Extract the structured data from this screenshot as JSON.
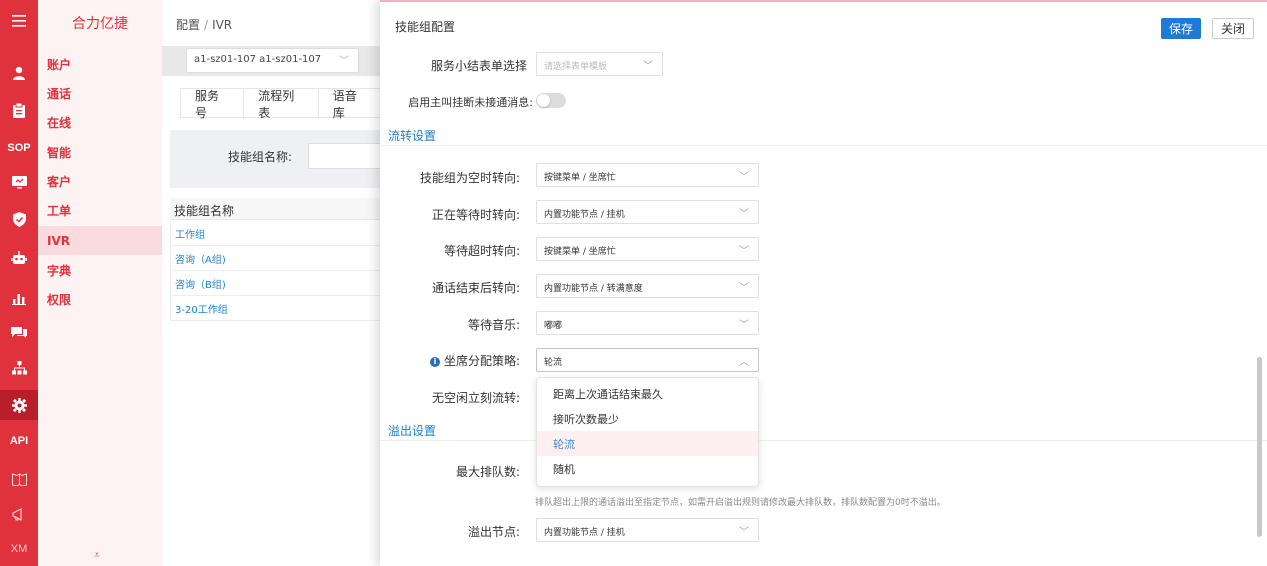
{
  "rail": {
    "items": [
      {
        "icon": "menu-icon",
        "glyph": "≡"
      },
      {
        "icon": "user-icon",
        "glyph": "♟"
      },
      {
        "icon": "clipboard-icon",
        "glyph": "▤"
      },
      {
        "icon": "sop-icon",
        "text": "SOP"
      },
      {
        "icon": "monitor-icon",
        "glyph": "▣"
      },
      {
        "icon": "shield-icon",
        "glyph": "⛉"
      },
      {
        "icon": "robot-icon",
        "glyph": "⚇"
      },
      {
        "icon": "bar-chart-icon",
        "glyph": "▁▃▆"
      },
      {
        "icon": "chat-icon",
        "glyph": "✉"
      },
      {
        "icon": "org-chart-icon",
        "glyph": "⚲"
      },
      {
        "icon": "gear-icon",
        "glyph": "✹"
      },
      {
        "icon": "api-icon",
        "text": "API"
      },
      {
        "icon": "book-icon",
        "glyph": "⊞"
      },
      {
        "icon": "megaphone-icon",
        "glyph": "◁"
      },
      {
        "icon": "xm-icon",
        "text": "XM"
      }
    ]
  },
  "menu": {
    "brand": "合力亿捷",
    "items": [
      "账户",
      "通话",
      "在线",
      "智能",
      "客户",
      "工单",
      "IVR",
      "字典",
      "权限"
    ],
    "active": "IVR",
    "collapse": "⩡"
  },
  "page": {
    "breadcrumb": [
      "配置",
      "IVR"
    ],
    "project_select": "a1-sz01-107 a1-sz01-107",
    "tabs": [
      "服务号",
      "流程列表",
      "语音库"
    ],
    "filter_label": "技能组名称:",
    "table_header": "技能组名称",
    "rows": [
      "工作组",
      "咨询（A组)",
      "咨询（B组)",
      "3-20工作组"
    ]
  },
  "drawer": {
    "title": "技能组配置",
    "save_label": "保存",
    "close_label": "关闭",
    "summary_form": {
      "label": "服务小结表单选择",
      "placeholder": "请选择表单模板"
    },
    "hangup_toggle": {
      "label": "启用主叫挂断未接通消息:",
      "on": false
    },
    "flow_section": "流转设置",
    "fields": [
      {
        "label": "技能组为空时转向:",
        "value": "按键菜单 / 坐席忙"
      },
      {
        "label": "正在等待时转向:",
        "value": "内置功能节点 / 挂机"
      },
      {
        "label": "等待超时转向:",
        "value": "按键菜单 / 坐席忙"
      },
      {
        "label": "通话结束后转向:",
        "value": "内置功能节点 / 转满意度"
      },
      {
        "label": "等待音乐:",
        "value": "嘟嘟"
      }
    ],
    "strategy": {
      "label": "坐席分配策略:",
      "value": "轮流"
    },
    "idle_label": "无空闲立刻流转:",
    "overflow_section": "溢出设置",
    "max_queue_label": "最大排队数:",
    "hint": "排队超出上限的通话溢出至指定节点，如需开启溢出规则请修改最大排队数，排队数配置为0时不溢出。",
    "overflow_node": {
      "label": "溢出节点:",
      "value": "内置功能节点 / 挂机"
    },
    "dropdown_options": [
      "距离上次通话结束最久",
      "接听次数最少",
      "轮流",
      "随机"
    ],
    "dropdown_selected": "轮流"
  },
  "colors": {
    "brand_red": "#e0323d",
    "primary_blue": "#1f7ad6",
    "link_blue": "#1f80d1"
  }
}
